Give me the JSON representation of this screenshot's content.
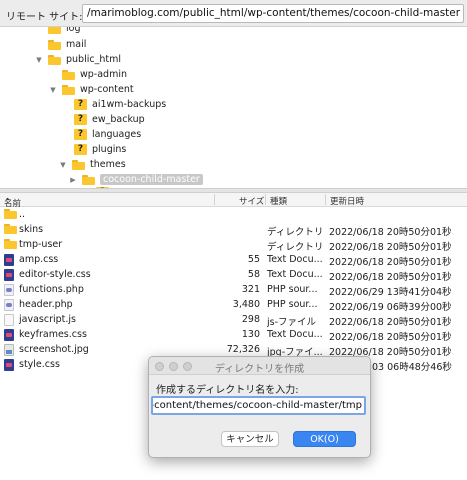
{
  "sitebar": {
    "label": "リモート サイト:",
    "path": "/marimoblog.com/public_html/wp-content/themes/cocoon-child-master"
  },
  "tree": {
    "nodes": [
      {
        "name": "log"
      },
      {
        "name": "mail"
      },
      {
        "name": "public_html",
        "toggle": "▼"
      },
      {
        "name": "wp-admin"
      },
      {
        "name": "wp-content",
        "toggle": "▼"
      },
      {
        "name": "ai1wm-backups"
      },
      {
        "name": "ew_backup"
      },
      {
        "name": "languages"
      },
      {
        "name": "plugins"
      },
      {
        "name": "themes",
        "toggle": "▼"
      },
      {
        "name": "cocoon-child-master",
        "toggle": "▶"
      }
    ]
  },
  "list": {
    "headers": {
      "name": "名前",
      "size": "サイズ",
      "type": "種類",
      "modified": "更新日時"
    },
    "sort_arrow": "⌃",
    "rows": [
      {
        "name": "..",
        "icon": "folder-icon",
        "size": "",
        "type": "",
        "modified": ""
      },
      {
        "name": "skins",
        "icon": "folder-icon",
        "size": "",
        "type": "ディレクトリ",
        "modified": "2022/06/18 20時50分01秒"
      },
      {
        "name": "tmp-user",
        "icon": "folder-icon",
        "size": "",
        "type": "ディレクトリ",
        "modified": "2022/06/18 20時50分01秒"
      },
      {
        "name": "amp.css",
        "icon": "css-file-icon",
        "size": "55",
        "type": "Text Docu...",
        "modified": "2022/06/18 20時50分01秒"
      },
      {
        "name": "editor-style.css",
        "icon": "css-file-icon",
        "size": "58",
        "type": "Text Docu...",
        "modified": "2022/06/18 20時50分01秒"
      },
      {
        "name": "functions.php",
        "icon": "php-file-icon",
        "size": "321",
        "type": "PHP sour...",
        "modified": "2022/06/29 13時41分04秒"
      },
      {
        "name": "header.php",
        "icon": "php-file-icon",
        "size": "3,480",
        "type": "PHP sour...",
        "modified": "2022/06/19 06時39分00秒"
      },
      {
        "name": "javascript.js",
        "icon": "js-file-icon",
        "size": "298",
        "type": "js-ファイル",
        "modified": "2022/06/18 20時50分01秒"
      },
      {
        "name": "keyframes.css",
        "icon": "css-file-icon",
        "size": "130",
        "type": "Text Docu...",
        "modified": "2022/06/18 20時50分01秒"
      },
      {
        "name": "screenshot.jpg",
        "icon": "jpg-file-icon",
        "size": "72,326",
        "type": "jpg-ファイ...",
        "modified": "2022/06/18 20時50分01秒"
      },
      {
        "name": "style.css",
        "icon": "css-file-icon",
        "size": "",
        "type": "",
        "modified": "03 06時48分46秒"
      }
    ]
  },
  "dialog": {
    "title": "ディレクトリを作成",
    "prompt": "作成するディレクトリ名を入力:",
    "input_value": "/marimoblog.com/public_html/wp-content/themes/cocoon-child-master/tmp",
    "cancel_label": "キャンセル",
    "ok_label": "OK(O)"
  },
  "colors": {
    "folder": "#fcc72e",
    "accent": "#3a86f0",
    "selection": "#c8c8c8"
  }
}
